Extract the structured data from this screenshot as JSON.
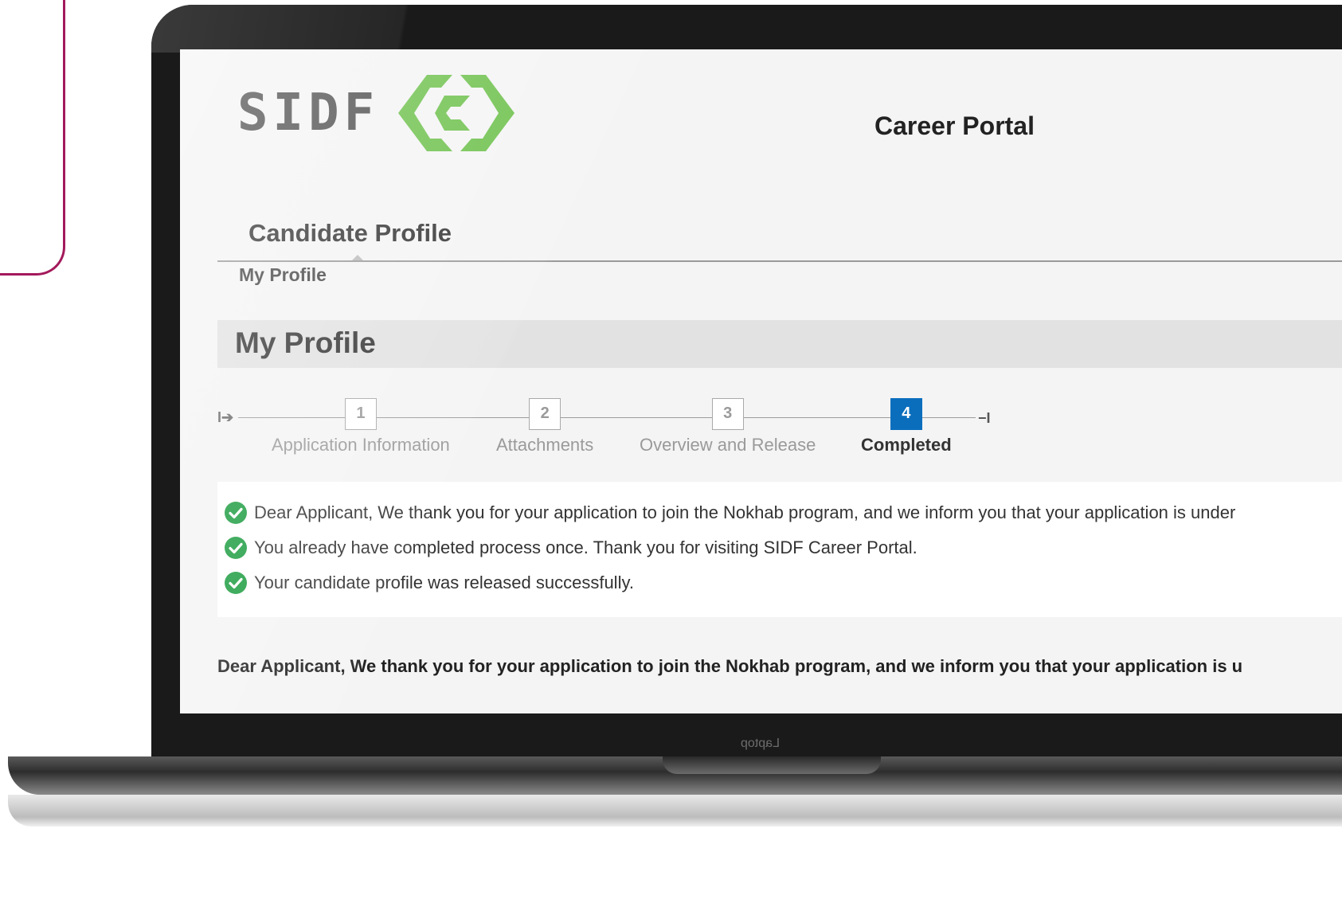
{
  "header": {
    "logo_text": "SIDF",
    "portal_title": "Career Portal"
  },
  "section": {
    "title": "Candidate Profile",
    "breadcrumb": "My Profile"
  },
  "page": {
    "title": "My Profile"
  },
  "stepper": {
    "steps": [
      {
        "number": "1",
        "label": "Application Information",
        "state": "done"
      },
      {
        "number": "2",
        "label": "Attachments",
        "state": "done"
      },
      {
        "number": "3",
        "label": "Overview and Release",
        "state": "done"
      },
      {
        "number": "4",
        "label": "Completed",
        "state": "active"
      }
    ]
  },
  "messages": [
    {
      "icon": "check-circle-icon",
      "text": "Dear Applicant, We thank you for your application to join the Nokhab program, and we inform you that your application is under"
    },
    {
      "icon": "check-circle-icon",
      "text": "You already have completed process once. Thank you for visiting SIDF Career Portal."
    },
    {
      "icon": "check-circle-icon",
      "text": "Your candidate profile was released successfully."
    }
  ],
  "footer_text": "Dear Applicant, We thank you for your application to join the Nokhab program, and we inform you that your application is u",
  "device": {
    "label": "Laptop"
  },
  "colors": {
    "accent_blue": "#0a6ebd",
    "success_green": "#1a9b3e",
    "logo_green": "#6cc04a",
    "frame_magenta": "#a3195b"
  }
}
